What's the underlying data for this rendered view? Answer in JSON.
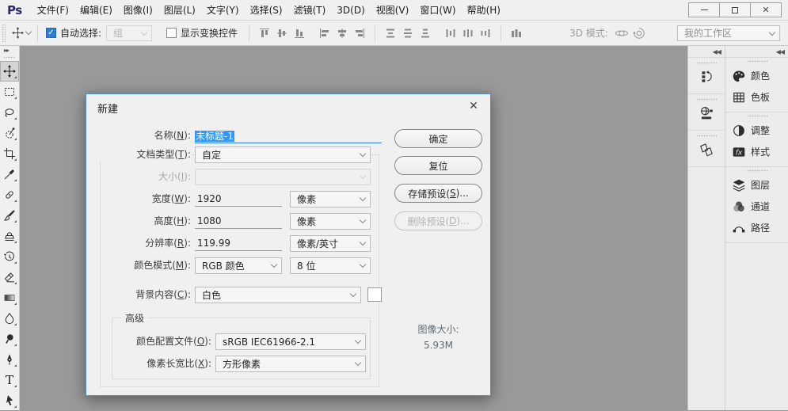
{
  "app": {
    "logo": "Ps",
    "window_controls": [
      "minimize",
      "maximize",
      "close"
    ]
  },
  "menubar": {
    "items": [
      "文件(F)",
      "编辑(E)",
      "图像(I)",
      "图层(L)",
      "文字(Y)",
      "选择(S)",
      "滤镜(T)",
      "3D(D)",
      "视图(V)",
      "窗口(W)",
      "帮助(H)"
    ]
  },
  "options_bar": {
    "tool": "move",
    "auto_select": {
      "label": "自动选择:",
      "checked": true,
      "value": "组"
    },
    "show_transform": {
      "label": "显示变换控件",
      "checked": false
    },
    "align_icons": [
      "align-top",
      "align-vertical-center",
      "align-bottom",
      "align-left",
      "align-horizontal-center",
      "align-right",
      "distribute-top",
      "distribute-vertical-center",
      "distribute-bottom",
      "distribute-left",
      "distribute-horizontal-center",
      "distribute-right",
      "auto-align"
    ],
    "mode_label": "3D 模式:",
    "mode_icons": [
      "3d-orbit",
      "3d-roll"
    ],
    "workspace": "我的工作区"
  },
  "toolbar": {
    "selected": "move",
    "tools": [
      "move",
      "rectangular-marquee",
      "lasso",
      "quick-selection",
      "crop",
      "eyedropper",
      "healing-brush",
      "brush",
      "clone-stamp",
      "history-brush",
      "eraser",
      "gradient",
      "blur",
      "dodge",
      "pen",
      "type",
      "path-selection"
    ]
  },
  "dialog": {
    "title": "新建",
    "name": {
      "label": "名称(N):",
      "value": "未标题-1"
    },
    "doc_type": {
      "label": "文档类型(T):",
      "value": "自定"
    },
    "size": {
      "label": "大小(I):",
      "value": "",
      "disabled": true
    },
    "width": {
      "label": "宽度(W):",
      "value": "1920",
      "unit": "像素"
    },
    "height": {
      "label": "高度(H):",
      "value": "1080",
      "unit": "像素"
    },
    "resolution": {
      "label": "分辨率(R):",
      "value": "119.99",
      "unit": "像素/英寸"
    },
    "color_mode": {
      "label": "颜色模式(M):",
      "value": "RGB 颜色",
      "depth": "8 位"
    },
    "background": {
      "label": "背景内容(C):",
      "value": "白色",
      "swatch": "#ffffff"
    },
    "advanced": {
      "legend": "高级",
      "color_profile": {
        "label": "颜色配置文件(O):",
        "value": "sRGB IEC61966-2.1"
      },
      "pixel_aspect": {
        "label": "像素长宽比(X):",
        "value": "方形像素"
      }
    },
    "buttons": {
      "ok": "确定",
      "reset": "复位",
      "save_preset": "存储预设(S)...",
      "delete_preset": "删除预设(D)..."
    },
    "image_size": {
      "label": "图像大小:",
      "value": "5.93M"
    }
  },
  "right_dock": {
    "icon_column_panels": [
      "history",
      "3d",
      "info"
    ],
    "panel_groups": [
      {
        "items": [
          {
            "label": "颜色",
            "icon": "color-palette"
          },
          {
            "label": "色板",
            "icon": "swatches-grid"
          }
        ]
      },
      {
        "items": [
          {
            "label": "调整",
            "icon": "adjustments"
          },
          {
            "label": "样式",
            "icon": "styles-fx"
          }
        ]
      },
      {
        "items": [
          {
            "label": "图层",
            "icon": "layers"
          },
          {
            "label": "通道",
            "icon": "channels"
          },
          {
            "label": "路径",
            "icon": "paths"
          }
        ]
      }
    ]
  },
  "colors": {
    "canvas_bg": "#999999",
    "chrome_bg": "#f0f0f0",
    "dialog_border": "#4a8fc7",
    "selection_blue": "#3297fd",
    "checkbox_blue": "#2d7dd2"
  }
}
